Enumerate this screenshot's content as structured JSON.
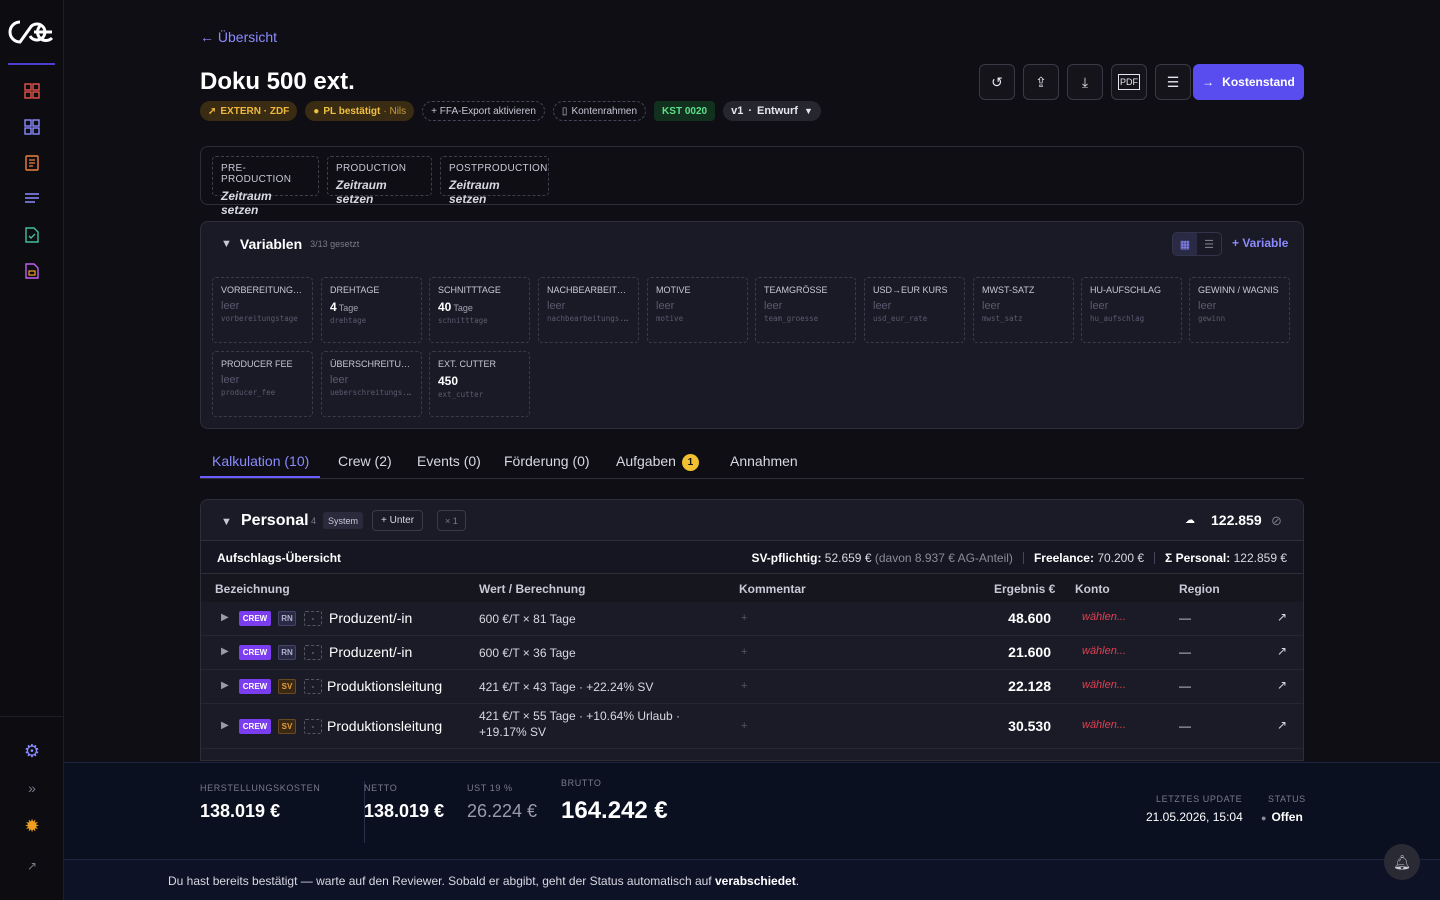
{
  "colors": {
    "accent": "#5a4df0",
    "link": "#8b8bff",
    "crew": "#7b3df0",
    "warn": "#f0b73a",
    "danger": "#e04050",
    "ok": "#5ee08a"
  },
  "sidebar": {
    "icons": [
      "logo-icon",
      "grid-icon",
      "dashboard-icon",
      "document-icon",
      "list-icon",
      "file-check-icon",
      "file-lock-icon",
      "settings-icon",
      "expand-icon",
      "sun-icon",
      "external-icon"
    ]
  },
  "header": {
    "back": "← Übersicht",
    "title": "Doku 500 ext.",
    "chips": {
      "extern": "EXTERN · ZDF",
      "pl": "PL bestätigt",
      "pl_user": "· Nils",
      "ffa": "+ FFA-Export aktivieren",
      "konten": "Kontenrahmen",
      "kst": "KST 0020",
      "version": "v1",
      "status": "Entwurf"
    },
    "kostenstand": "Kostenstand"
  },
  "phases": [
    {
      "label": "PRE-PRODUCTION",
      "value": "Zeitraum setzen"
    },
    {
      "label": "PRODUCTION",
      "value": "Zeitraum setzen"
    },
    {
      "label": "POSTPRODUCTION",
      "value": "Zeitraum setzen"
    }
  ],
  "variables": {
    "title": "Variablen",
    "count": "3/13 gesetzt",
    "add": "+ Variable",
    "items": [
      {
        "label": "VORBEREITUNGST...",
        "value": "leer",
        "unit": "",
        "key": "vorbereitungstage"
      },
      {
        "label": "DREHTAGE",
        "value": "4",
        "unit": "Tage",
        "key": "drehtage"
      },
      {
        "label": "SCHNITTTAGE",
        "value": "40",
        "unit": "Tage",
        "key": "schnitttage"
      },
      {
        "label": "NACHBEARBEITU...",
        "value": "leer",
        "unit": "",
        "key": "nachbearbeitungs..."
      },
      {
        "label": "MOTIVE",
        "value": "leer",
        "unit": "",
        "key": "motive"
      },
      {
        "label": "TEAMGRÖSSE",
        "value": "leer",
        "unit": "",
        "key": "team_groesse"
      },
      {
        "label": "USD→EUR KURS",
        "value": "leer",
        "unit": "",
        "key": "usd_eur_rate"
      },
      {
        "label": "MWST-SATZ",
        "value": "leer",
        "unit": "",
        "key": "mwst_satz"
      },
      {
        "label": "HU-AUFSCHLAG",
        "value": "leer",
        "unit": "",
        "key": "hu_aufschlag"
      },
      {
        "label": "GEWINN / WAGNIS",
        "value": "leer",
        "unit": "",
        "key": "gewinn"
      },
      {
        "label": "PRODUCER FEE",
        "value": "leer",
        "unit": "",
        "key": "producer_fee"
      },
      {
        "label": "ÜBERSCHREITUN...",
        "value": "leer",
        "unit": "",
        "key": "ueberschreitungs..."
      },
      {
        "label": "EXT. CUTTER",
        "value": "450",
        "unit": "",
        "key": "ext_cutter"
      }
    ]
  },
  "tabs": [
    "Kalkulation (10)",
    "Crew (2)",
    "Events (0)",
    "Förderung (0)",
    "Aufgaben",
    "Annahmen"
  ],
  "tasks_badge": "1",
  "section": {
    "title": "Personal",
    "count": "4",
    "system": "System",
    "unter": "+ Unter",
    "x1": "× 1",
    "total": "122.859",
    "summary_label": "Aufschlags-Übersicht",
    "sv_label": "SV-pflichtig:",
    "sv_value": "52.659 €",
    "sv_extra": "(davon 8.937 € AG-Anteil)",
    "freelance_label": "Freelance:",
    "freelance_value": "70.200 €",
    "personal_label": "Σ Personal:",
    "personal_value": "122.859 €",
    "columns": [
      "Bezeichnung",
      "Wert / Berechnung",
      "Kommentar",
      "Ergebnis €",
      "Konto",
      "Region"
    ],
    "rows": [
      {
        "tag1": "CREW",
        "tag2": "RN",
        "name": "Produzent/-in",
        "calc": "600 €/T × 81 Tage",
        "plus": "+",
        "result": "48.600",
        "konto": "wählen...",
        "region": "—"
      },
      {
        "tag1": "CREW",
        "tag2": "RN",
        "name": "Produzent/-in",
        "calc": "600 €/T × 36 Tage",
        "plus": "+",
        "result": "21.600",
        "konto": "wählen...",
        "region": "—"
      },
      {
        "tag1": "CREW",
        "tag2": "SV",
        "name": "Produktionsleitung",
        "calc": "421 €/T × 43 Tage · +22.24% SV",
        "plus": "+",
        "result": "22.128",
        "konto": "wählen...",
        "region": "—"
      },
      {
        "tag1": "CREW",
        "tag2": "SV",
        "name": "Produktionsleitung",
        "calc": "421 €/T × 55 Tage · +10.64% Urlaub · +19.17% SV",
        "plus": "+",
        "result": "30.530",
        "konto": "wählen...",
        "region": "—"
      }
    ]
  },
  "footer": {
    "hk_label": "HERSTELLUNGSKOSTEN",
    "hk_value": "138.019 €",
    "netto_label": "NETTO",
    "netto_value": "138.019 €",
    "ust_label": "UST 19 %",
    "ust_value": "26.224 €",
    "brutto_label": "BRUTTO",
    "brutto_value": "164.242 €",
    "update_label": "LETZTES UPDATE",
    "update_value": "21.05.2026, 15:04",
    "status_label": "STATUS",
    "status_value": "Offen"
  },
  "notice": {
    "text": "Du hast bereits bestätigt — warte auf den Reviewer. Sobald er abgibt, geht der Status automatisch auf",
    "bold": "verabschiedet",
    "end": "."
  }
}
